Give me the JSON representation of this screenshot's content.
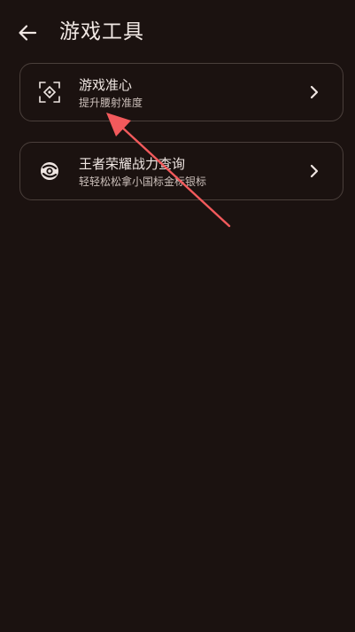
{
  "header": {
    "title": "游戏工具",
    "back_icon": "arrow-left-icon"
  },
  "tools": [
    {
      "title": "游戏准心",
      "subtitle": "提升腰射准度",
      "icon": "crosshair-icon"
    },
    {
      "title": "王者荣耀战力查询",
      "subtitle": "轻轻松松拿小国标金标银标",
      "icon": "target-icon"
    }
  ],
  "colors": {
    "background": "#1b1210",
    "card_border": "#4a3f3b",
    "text_primary": "#efe6e2",
    "text_secondary": "#cbbfba",
    "annotation": "#f25a5c"
  }
}
